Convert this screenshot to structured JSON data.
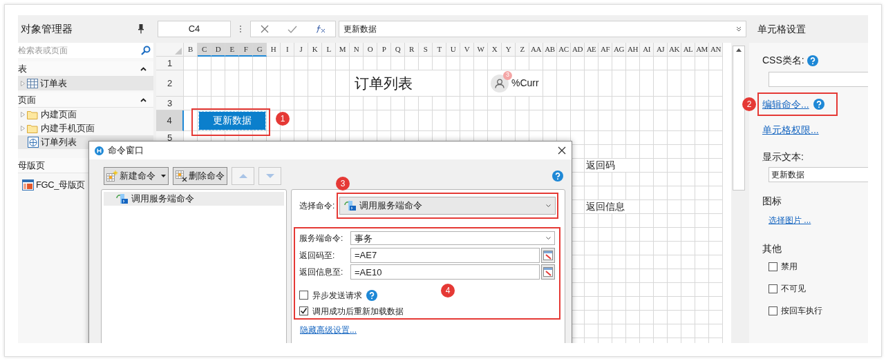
{
  "object_manager": {
    "title": "对象管理器",
    "search": {
      "placeholder": "检索表或页面"
    },
    "sections": [
      {
        "title": "表",
        "expanded": true,
        "items": [
          {
            "kind": "table",
            "label": "订单表",
            "selected": true
          }
        ]
      },
      {
        "title": "页面",
        "expanded": true,
        "items": [
          {
            "kind": "folder",
            "label": "内建页面",
            "selected": false
          },
          {
            "kind": "folder",
            "label": "内建手机页面",
            "selected": false
          },
          {
            "kind": "page",
            "label": "订单列表",
            "selected": true
          }
        ]
      },
      {
        "title": "母版页",
        "items": [
          {
            "kind": "master",
            "label": "FGC_母版页",
            "selected": false
          }
        ]
      }
    ]
  },
  "formula_bar": {
    "cell_ref": "C4",
    "formula": "更新数据"
  },
  "sheet": {
    "columns": [
      {
        "label": "B",
        "selected": false
      },
      {
        "label": "C",
        "selected": true
      },
      {
        "label": "D",
        "selected": true
      },
      {
        "label": "E",
        "selected": true
      },
      {
        "label": "F",
        "selected": true
      },
      {
        "label": "G",
        "selected": true
      },
      {
        "label": "H",
        "selected": false
      },
      {
        "label": "I",
        "selected": false
      },
      {
        "label": "J",
        "selected": false
      },
      {
        "label": "K",
        "selected": false
      },
      {
        "label": "L",
        "selected": false
      },
      {
        "label": "M",
        "selected": false
      },
      {
        "label": "N",
        "selected": false
      },
      {
        "label": "O",
        "selected": false
      },
      {
        "label": "P",
        "selected": false
      },
      {
        "label": "Q",
        "selected": false
      },
      {
        "label": "R",
        "selected": false
      },
      {
        "label": "S",
        "selected": false
      },
      {
        "label": "T",
        "selected": false
      },
      {
        "label": "U",
        "selected": false
      },
      {
        "label": "V",
        "selected": false
      },
      {
        "label": "W",
        "selected": false
      },
      {
        "label": "X",
        "selected": false
      },
      {
        "label": "Y",
        "selected": false
      },
      {
        "label": "Z",
        "selected": false
      },
      {
        "label": "AA",
        "selected": false
      },
      {
        "label": "AB",
        "selected": false
      },
      {
        "label": "AC",
        "selected": false
      },
      {
        "label": "AD",
        "selected": false
      },
      {
        "label": "AE",
        "selected": false
      },
      {
        "label": "AF",
        "selected": false
      },
      {
        "label": "AG",
        "selected": false
      },
      {
        "label": "AH",
        "selected": false
      },
      {
        "label": "AI",
        "selected": false
      },
      {
        "label": "AJ",
        "selected": false
      },
      {
        "label": "AK",
        "selected": false
      },
      {
        "label": "AL",
        "selected": false
      },
      {
        "label": "AM",
        "selected": false
      },
      {
        "label": "AN",
        "selected": false
      }
    ],
    "rows": [
      {
        "label": "1",
        "selected": false
      },
      {
        "label": "2",
        "selected": false
      },
      {
        "label": "3",
        "selected": false
      },
      {
        "label": "4",
        "selected": true
      },
      {
        "label": "5",
        "selected": false
      }
    ],
    "page_title": "订单列表",
    "avatar_badge": "3",
    "user_text": "%Curr",
    "button": {
      "label": "更新数据",
      "callout": "1"
    },
    "return_code_label": "返回码",
    "return_info_label": "返回信息"
  },
  "cell_settings": {
    "title": "单元格设置",
    "css_label": "CSS类名:",
    "edit_command_link": "编辑命令...",
    "edit_command_callout": "2",
    "permission_link": "单元格权限...",
    "display_text_label": "显示文本:",
    "display_text_value": "更新数据",
    "icon_label": "图标",
    "choose_image_link": "选择图片 ...",
    "other_label": "其他",
    "checkboxes": [
      {
        "label": "禁用",
        "checked": false
      },
      {
        "label": "不可见",
        "checked": false
      },
      {
        "label": "按回车执行",
        "checked": false
      }
    ]
  },
  "dialog": {
    "title": "命令窗口",
    "new_command": "新建命令",
    "delete_command": "删除命令",
    "move_up_disabled": true,
    "move_down_disabled": true,
    "commands": [
      {
        "label": "调用服务端命令",
        "selected": true
      }
    ],
    "select_label": "选择命令:",
    "select_value": "调用服务端命令",
    "select_callout": "3",
    "server_command_label": "服务端命令:",
    "server_command_value": "事务",
    "return_code_label": "返回码至:",
    "return_code_value": "=AE7",
    "return_info_label": "返回信息至:",
    "return_info_value": "=AE10",
    "options": [
      {
        "label": "异步发送请求",
        "checked": false,
        "help": true
      },
      {
        "label": "调用成功后重新加载数据",
        "checked": true,
        "help": false
      }
    ],
    "options_callout": "4",
    "advanced_link": "隐藏高级设置..."
  }
}
